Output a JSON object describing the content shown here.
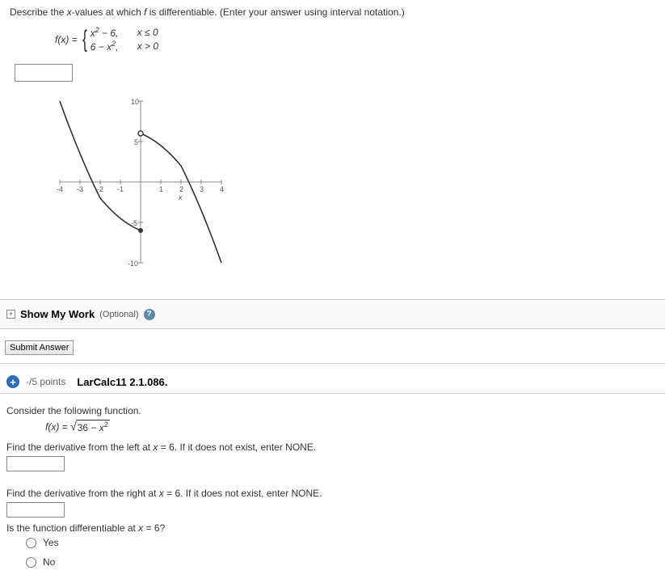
{
  "q1": {
    "prompt_prefix": "Describe the ",
    "prompt_var": "x",
    "prompt_mid": "-values at which ",
    "prompt_f": "f",
    "prompt_suffix": " is differentiable. (Enter your answer using interval notation.)",
    "fx": "f(x) = ",
    "piece1_expr": "x² − 6,",
    "piece1_cond": "x ≤ 0",
    "piece2_expr": "6 − x²,",
    "piece2_cond": "x > 0",
    "show_work": "Show My Work",
    "optional": "(Optional)",
    "submit": "Submit Answer"
  },
  "q2": {
    "points": "-/5 points",
    "ref": "LarCalc11 2.1.086.",
    "consider": "Consider the following function.",
    "fx_left": "f(x) = ",
    "sqrt_body": "36 − x²",
    "left_deriv_a": "Find the derivative from the left at ",
    "left_deriv_b": "x",
    "left_deriv_c": " = 6. If it does not exist, enter NONE.",
    "right_deriv_a": "Find the derivative from the right at ",
    "right_deriv_b": "x",
    "right_deriv_c": " = 6. If it does not exist, enter NONE.",
    "diff_q_a": "Is the function differentiable at ",
    "diff_q_b": "x",
    "diff_q_c": " = 6?",
    "yes": "Yes",
    "no": "No"
  },
  "chart_data": {
    "type": "line",
    "title": "",
    "xlabel": "x",
    "ylabel": "",
    "xlim": [
      -4,
      4
    ],
    "ylim": [
      -10,
      10
    ],
    "series": [
      {
        "name": "x^2 - 6 (x ≤ 0)",
        "x": [
          -4,
          -3,
          -2,
          -1,
          0
        ],
        "y": [
          10,
          3,
          -2,
          -5,
          -6
        ]
      },
      {
        "name": "6 - x^2 (x > 0)",
        "x": [
          0,
          1,
          2,
          3,
          4
        ],
        "y": [
          6,
          5,
          2,
          -3,
          -10
        ]
      }
    ],
    "markers": [
      {
        "x": 0,
        "y": -6,
        "type": "closed"
      },
      {
        "x": 0,
        "y": 6,
        "type": "open"
      }
    ]
  }
}
